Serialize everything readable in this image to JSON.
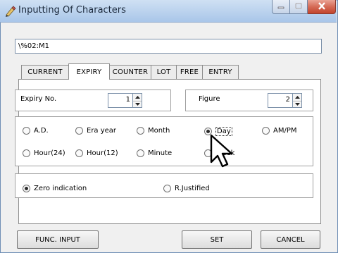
{
  "window": {
    "title": "Inputting Of Characters"
  },
  "command_input": {
    "value": "\\%02:M1"
  },
  "tabs": [
    {
      "label": "CURRENT",
      "active": false
    },
    {
      "label": "EXPIRY",
      "active": true
    },
    {
      "label": "COUNTER",
      "active": false
    },
    {
      "label": "LOT",
      "active": false
    },
    {
      "label": "FREE",
      "active": false
    },
    {
      "label": "ENTRY",
      "active": false
    }
  ],
  "expiry": {
    "expiry_no_label": "Expiry No.",
    "expiry_no_value": "1",
    "figure_label": "Figure",
    "figure_value": "2"
  },
  "date_options": {
    "ad": "A.D.",
    "era_year": "Era year",
    "month": "Month",
    "day": "Day",
    "ampm": "AM/PM",
    "hour24": "Hour(24)",
    "hour12": "Hour(12)",
    "minute": "Minute",
    "week": "Week",
    "selected": "Day"
  },
  "justify_options": {
    "zero": "Zero indication",
    "rjust": "R.Justified",
    "selected": "Zero indication"
  },
  "buttons": {
    "func_input": "FUNC. INPUT",
    "set": "SET",
    "cancel": "CANCEL"
  },
  "icons": {
    "app": "pen-icon",
    "minimize": "minimize-icon",
    "maximize": "maximize-icon",
    "close": "close-icon",
    "cursor": "mouse-pointer-icon"
  },
  "colors": {
    "titlebar": "#bcd3ee",
    "close_button": "#d56b57",
    "window_bg": "#f0f0f0"
  }
}
